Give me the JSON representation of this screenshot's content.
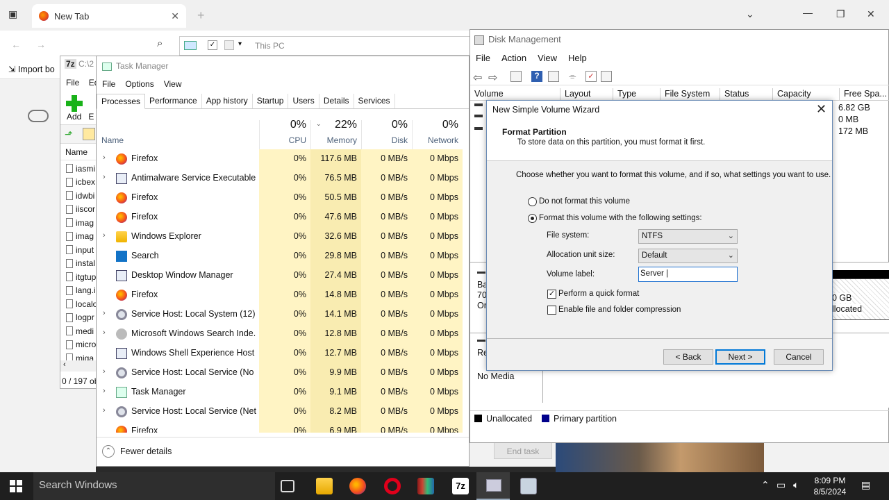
{
  "browser": {
    "tab_title": "New Tab",
    "bookmark": "Import bo",
    "tab_close": "✕",
    "new_tab": "+"
  },
  "zip": {
    "title": "C:\\2",
    "menu": [
      "File",
      "Ed"
    ],
    "add_label": "Add",
    "extract_label": "E",
    "col_name": "Name",
    "files": [
      "iasmi",
      "icbex",
      "idwbi",
      "iiscor",
      "imag",
      "imag",
      "input",
      "instal",
      "itgtup",
      "lang.i",
      "localo",
      "logpr",
      "medi",
      "micro",
      "miga"
    ],
    "status": "0 / 197 ob"
  },
  "thispc": {
    "title": "This PC"
  },
  "taskmgr": {
    "title": "Task Manager",
    "menu": [
      "File",
      "Options",
      "View"
    ],
    "tabs": [
      "Processes",
      "Performance",
      "App history",
      "Startup",
      "Users",
      "Details",
      "Services"
    ],
    "active_tab": "Processes",
    "col_name": "Name",
    "headers": {
      "cpu_pct": "0%",
      "cpu": "CPU",
      "mem_pct": "22%",
      "mem": "Memory",
      "disk_pct": "0%",
      "disk": "Disk",
      "net_pct": "0%",
      "net": "Network"
    },
    "rows": [
      {
        "name": "Firefox",
        "icon": "firefox-icon",
        "expand": true,
        "cpu": "0%",
        "mem": "117.6 MB",
        "disk": "0 MB/s",
        "net": "0 Mbps"
      },
      {
        "name": "Antimalware Service Executable",
        "icon": "window-icon",
        "expand": true,
        "cpu": "0%",
        "mem": "76.5 MB",
        "disk": "0 MB/s",
        "net": "0 Mbps"
      },
      {
        "name": "Firefox",
        "icon": "firefox-icon",
        "expand": false,
        "cpu": "0%",
        "mem": "50.5 MB",
        "disk": "0 MB/s",
        "net": "0 Mbps"
      },
      {
        "name": "Firefox",
        "icon": "firefox-icon",
        "expand": false,
        "cpu": "0%",
        "mem": "47.6 MB",
        "disk": "0 MB/s",
        "net": "0 Mbps"
      },
      {
        "name": "Windows Explorer",
        "icon": "folder-icon",
        "expand": true,
        "cpu": "0%",
        "mem": "32.6 MB",
        "disk": "0 MB/s",
        "net": "0 Mbps"
      },
      {
        "name": "Search",
        "icon": "search-icon",
        "expand": false,
        "cpu": "0%",
        "mem": "29.8 MB",
        "disk": "0 MB/s",
        "net": "0 Mbps"
      },
      {
        "name": "Desktop Window Manager",
        "icon": "window-icon",
        "expand": false,
        "cpu": "0%",
        "mem": "27.4 MB",
        "disk": "0 MB/s",
        "net": "0 Mbps"
      },
      {
        "name": "Firefox",
        "icon": "firefox-icon",
        "expand": false,
        "cpu": "0%",
        "mem": "14.8 MB",
        "disk": "0 MB/s",
        "net": "0 Mbps"
      },
      {
        "name": "Service Host: Local System (12)",
        "icon": "gear-icon",
        "expand": true,
        "cpu": "0%",
        "mem": "14.1 MB",
        "disk": "0 MB/s",
        "net": "0 Mbps"
      },
      {
        "name": "Microsoft Windows Search Inde...",
        "icon": "user-icon",
        "expand": true,
        "cpu": "0%",
        "mem": "12.8 MB",
        "disk": "0 MB/s",
        "net": "0 Mbps"
      },
      {
        "name": "Windows Shell Experience Host",
        "icon": "window-icon",
        "expand": false,
        "cpu": "0%",
        "mem": "12.7 MB",
        "disk": "0 MB/s",
        "net": "0 Mbps"
      },
      {
        "name": "Service Host: Local Service (No ...",
        "icon": "gear-icon",
        "expand": true,
        "cpu": "0%",
        "mem": "9.9 MB",
        "disk": "0 MB/s",
        "net": "0 Mbps"
      },
      {
        "name": "Task Manager",
        "icon": "taskmgr-icon",
        "expand": true,
        "cpu": "0%",
        "mem": "9.1 MB",
        "disk": "0 MB/s",
        "net": "0 Mbps"
      },
      {
        "name": "Service Host: Local Service (Net...",
        "icon": "gear-icon",
        "expand": true,
        "cpu": "0%",
        "mem": "8.2 MB",
        "disk": "0 MB/s",
        "net": "0 Mbps"
      },
      {
        "name": "Firefox",
        "icon": "firefox-icon",
        "expand": false,
        "cpu": "0%",
        "mem": "6.9 MB",
        "disk": "0 MB/s",
        "net": "0 Mbps"
      }
    ],
    "fewer_details": "Fewer details",
    "end_task": "End task"
  },
  "diskmgmt": {
    "title": "Disk Management",
    "menu": [
      "File",
      "Action",
      "View",
      "Help"
    ],
    "columns": [
      "Volume",
      "Layout",
      "Type",
      "File System",
      "Status",
      "Capacity",
      "Free Spa..."
    ],
    "free_space": [
      "6.82 GB",
      "0 MB",
      "172 MB"
    ],
    "graph_left": [
      "Ba",
      "70.",
      "Or"
    ],
    "graph_right": [
      "0 GB",
      "llocated"
    ],
    "disk2_label": "Re",
    "no_media": "No Media",
    "legend": {
      "unallocated": "Unallocated",
      "primary": "Primary partition",
      "unallocated_color": "#000000",
      "primary_color": "#00008b"
    }
  },
  "wizard": {
    "title": "New Simple Volume Wizard",
    "heading": "Format Partition",
    "subheading": "To store data on this partition, you must format it first.",
    "instruction": "Choose whether you want to format this volume, and if so, what settings you want to use.",
    "option_no_format": "Do not format this volume",
    "option_format": "Format this volume with the following settings:",
    "fs_label": "File system:",
    "fs_value": "NTFS",
    "alloc_label": "Allocation unit size:",
    "alloc_value": "Default",
    "vol_label": "Volume label:",
    "vol_value": "Server |",
    "quick_format": "Perform a quick format",
    "compression": "Enable file and folder compression",
    "back": "< Back",
    "next": "Next >",
    "cancel": "Cancel"
  },
  "taskbar": {
    "search_placeholder": "Search Windows",
    "time": "8:09 PM",
    "date": "8/5/2024"
  }
}
